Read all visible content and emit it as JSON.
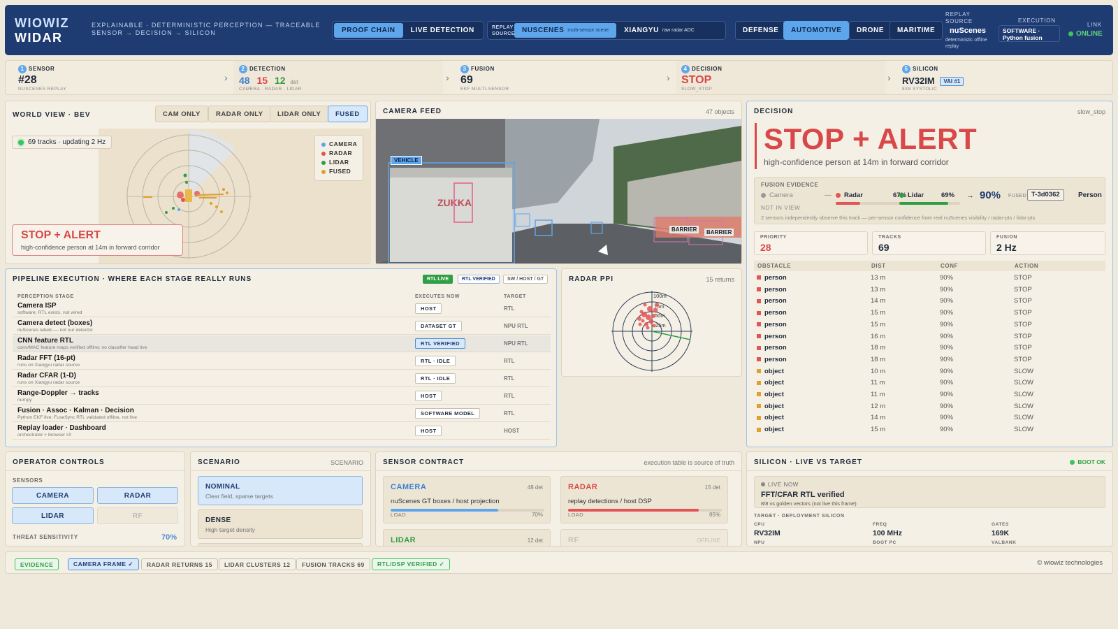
{
  "brand": {
    "line1": "WIOWIZ",
    "line2": "WIDAR",
    "tagline": "EXPLAINABLE · DETERMINISTIC PERCEPTION — TRACEABLE SENSOR → DECISION → SILICON"
  },
  "modes": [
    "PROOF CHAIN",
    "LIVE DETECTION"
  ],
  "replay_source": {
    "label": "REPLAY SOURCE",
    "options": [
      {
        "name": "NUSCENES",
        "sub": "multi-sensor scene"
      },
      {
        "name": "XIANGYU",
        "sub": "raw radar ADC"
      }
    ]
  },
  "domains": [
    "DEFENSE",
    "AUTOMOTIVE",
    "DRONE",
    "MARITIME"
  ],
  "header_status": {
    "replay_label": "REPLAY SOURCE",
    "replay_value": "nuScenes",
    "replay_sub": "deterministic offline replay",
    "exec_label": "EXECUTION",
    "exec_value": "SOFTWARE · Python fusion",
    "link_label": "LINK",
    "link_value": "ONLINE"
  },
  "stages": [
    {
      "num": "1",
      "name": "SENSOR",
      "value": "#28",
      "sub": "NUSCENES REPLAY"
    },
    {
      "num": "2",
      "name": "DETECTION",
      "v1": "48",
      "v2": "15",
      "v3": "12",
      "suffix": "det",
      "sub": "CAMERA · RADAR · LIDAR"
    },
    {
      "num": "3",
      "name": "FUSION",
      "value": "69",
      "sub": "EKF MULTI-SENSOR"
    },
    {
      "num": "4",
      "name": "DECISION",
      "value": "STOP",
      "sub": "SLOW_STOP"
    },
    {
      "num": "5",
      "name": "SILICON",
      "value": "RV32IM",
      "badge": "VAI #1",
      "sub": "8X8 SYSTOLIC"
    }
  ],
  "world_view": {
    "title": "WORLD VIEW · BEV",
    "filters": [
      "CAM ONLY",
      "RADAR ONLY",
      "LIDAR ONLY",
      "FUSED"
    ],
    "tracks_text": "69 tracks · updating 2 Hz",
    "legend": [
      "CAMERA",
      "RADAR",
      "LIDAR",
      "FUSED"
    ],
    "alert_title": "STOP + ALERT",
    "alert_sub": "high-confidence person at 14m in forward corridor"
  },
  "camera": {
    "title": "CAMERA FEED",
    "meta": "47 objects",
    "tag_vehicle": "VEHICLE",
    "tag_barrier1": "BARRIER",
    "tag_barrier2": "BARRIER",
    "truck_text": "ZUKKA"
  },
  "decision": {
    "title": "DECISION",
    "meta": "slow_stop",
    "headline": "STOP + ALERT",
    "sub": "high-confidence person at 14m in forward corridor",
    "evidence_label": "FUSION EVIDENCE",
    "cam_label": "Camera",
    "cam_dash": "—",
    "radar_label": "Radar",
    "radar_pct": "67%",
    "lidar_label": "Lidar",
    "lidar_pct": "69%",
    "arrow": "→",
    "fused_pct": "90%",
    "fused_label": "FUSED",
    "track_id": "T-3d0362",
    "class": "Person",
    "not_in_view": "NOT IN VIEW",
    "note": "2 sensors independently observe this track — per-sensor confidence from real nuScenes visibility / radar-pts / lidar-pts",
    "stats": [
      {
        "label": "PRIORITY",
        "value": "28"
      },
      {
        "label": "TRACKS",
        "value": "69"
      },
      {
        "label": "FUSION",
        "value": "2 Hz"
      }
    ],
    "columns": [
      "OBSTACLE",
      "DIST",
      "CONF",
      "ACTION"
    ],
    "rows": [
      [
        "person",
        "13 m",
        "90%",
        "STOP"
      ],
      [
        "person",
        "13 m",
        "90%",
        "STOP"
      ],
      [
        "person",
        "14 m",
        "90%",
        "STOP"
      ],
      [
        "person",
        "15 m",
        "90%",
        "STOP"
      ],
      [
        "person",
        "15 m",
        "90%",
        "STOP"
      ],
      [
        "person",
        "16 m",
        "90%",
        "STOP"
      ],
      [
        "person",
        "18 m",
        "90%",
        "STOP"
      ],
      [
        "person",
        "18 m",
        "90%",
        "STOP"
      ],
      [
        "object",
        "10 m",
        "90%",
        "SLOW"
      ],
      [
        "object",
        "11 m",
        "90%",
        "SLOW"
      ],
      [
        "object",
        "11 m",
        "90%",
        "SLOW"
      ],
      [
        "object",
        "12 m",
        "90%",
        "SLOW"
      ],
      [
        "object",
        "14 m",
        "90%",
        "SLOW"
      ],
      [
        "object",
        "15 m",
        "90%",
        "SLOW"
      ]
    ]
  },
  "pipeline": {
    "title": "PIPELINE EXECUTION · WHERE EACH STAGE REALLY RUNS",
    "badges": [
      "RTL LIVE",
      "RTL VERIFIED",
      "SW / HOST / GT"
    ],
    "columns": [
      "PERCEPTION STAGE",
      "EXECUTES NOW",
      "TARGET"
    ],
    "rows": [
      {
        "stage": "Camera ISP",
        "note": "software; RTL exists, not wired",
        "exec": "HOST",
        "target": "RTL"
      },
      {
        "stage": "Camera detect (boxes)",
        "note": "nuScenes labels — not our detector",
        "exec": "DATASET GT",
        "target": "NPU RTL"
      },
      {
        "stage": "CNN feature RTL",
        "note": "conv/MAC feature maps verified offline; no classifier head live",
        "exec": "RTL VERIFIED",
        "target": "NPU RTL"
      },
      {
        "stage": "Radar FFT (16-pt)",
        "note": "runs on Xiangyu radar source",
        "exec": "RTL · IDLE",
        "target": "RTL"
      },
      {
        "stage": "Radar CFAR (1-D)",
        "note": "runs on Xiangyu radar source",
        "exec": "RTL · IDLE",
        "target": "RTL"
      },
      {
        "stage": "Range-Doppler → tracks",
        "note": "numpy",
        "exec": "HOST",
        "target": "RTL"
      },
      {
        "stage": "Fusion · Assoc · Kalman · Decision",
        "note": "Python EKF live; FuseSync RTL validated offline, not live",
        "exec": "SOFTWARE MODEL",
        "target": "RTL"
      },
      {
        "stage": "Replay loader · Dashboard",
        "note": "orchestrator + browser UI",
        "exec": "HOST",
        "target": "HOST"
      }
    ]
  },
  "radar_ppi": {
    "title": "RADAR PPI",
    "meta": "15 returns",
    "r1": "100m",
    "r2": "75m",
    "r3": "50m",
    "r4": "25m"
  },
  "operator": {
    "title": "OPERATOR CONTROLS",
    "sensors_label": "SENSORS",
    "sensors": [
      "CAMERA",
      "RADAR",
      "LIDAR",
      "RF"
    ],
    "threat_label": "THREAT SENSITIVITY",
    "threat_value": "70%"
  },
  "scenario": {
    "title": "SCENARIO",
    "meta": "SCENARIO",
    "items": [
      {
        "name": "NOMINAL",
        "desc": "Clear field, sparse targets"
      },
      {
        "name": "DENSE",
        "desc": "High target density"
      }
    ]
  },
  "sensor_contract": {
    "title": "SENSOR CONTRACT",
    "meta": "execution table is source of truth",
    "cards": [
      {
        "name": "CAMERA",
        "count": "48 det",
        "desc": "nuScenes GT boxes / host projection",
        "load_label": "LOAD",
        "load": "70%",
        "color": "#5ea6ec"
      },
      {
        "name": "RADAR",
        "count": "15 det",
        "desc": "replay detections / host DSP",
        "load_label": "LOAD",
        "load": "85%",
        "color": "#e25555"
      },
      {
        "name": "LIDAR",
        "count": "12 det",
        "color": "#2f9e44"
      },
      {
        "name": "RF",
        "count": "OFFLINE",
        "color": "#c8c0b0"
      }
    ]
  },
  "silicon": {
    "title": "SILICON · LIVE VS TARGET",
    "status": "BOOT OK",
    "live_label": "LIVE NOW",
    "live_title": "FFT/CFAR RTL verified",
    "live_sub": "8/8 vs golden vectors (not live this frame)",
    "target_label": "TARGET · DEPLOYMENT SILICON",
    "specs": [
      {
        "label": "CPU",
        "value": "RV32IM"
      },
      {
        "label": "FREQ",
        "value": "100 MHz"
      },
      {
        "label": "GATES",
        "value": "169K"
      }
    ],
    "cut": [
      "NPU",
      "BOOT PC",
      "VALBANK"
    ]
  },
  "footer": {
    "chips": [
      "EVIDENCE",
      "CAMERA FRAME ✓",
      "RADAR RETURNS 15",
      "LIDAR CLUSTERS 12",
      "FUSION TRACKS 69",
      "RTL/DSP VERIFIED ✓"
    ],
    "copyright": "© wiowiz technologies"
  }
}
